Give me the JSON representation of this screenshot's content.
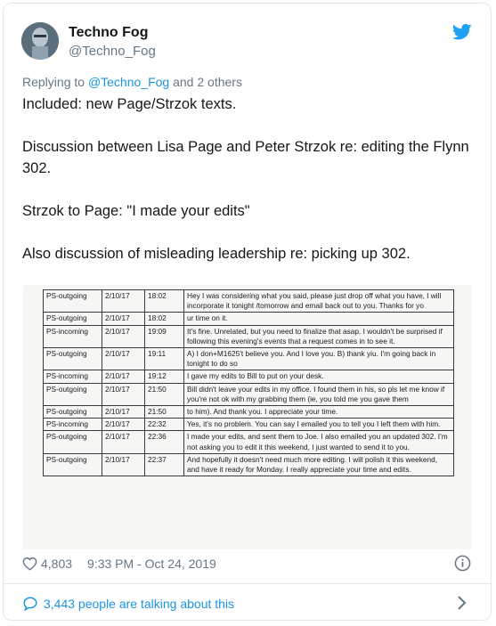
{
  "author": {
    "name": "Techno Fog",
    "handle": "@Techno_Fog"
  },
  "reply": {
    "prefix": "Replying to",
    "mention": "@Techno_Fog",
    "suffix": "and 2 others"
  },
  "tweet": {
    "paragraphs": [
      "Included: new Page/Strzok texts.",
      "Discussion between Lisa Page and Peter Strzok re: editing the Flynn 302.",
      "Strzok to Page: \"I made your edits\"",
      "Also discussion of misleading leadership re: picking up 302."
    ]
  },
  "document": {
    "rows": [
      {
        "dir": "PS-outgoing",
        "date": "2/10/17",
        "time": "18:02",
        "text": "Hey I was considering what you said, please just drop off what you have, I will incorporate it tonight /tomorrow and email back out to you. Thanks for yo"
      },
      {
        "dir": "PS-outgoing",
        "date": "2/10/17",
        "time": "18:02",
        "text": "ur time on it."
      },
      {
        "dir": "PS-incoming",
        "date": "2/10/17",
        "time": "19:09",
        "text": "It's fine.  Unrelated, but you need to finalize that asap.  I wouldn't be surprised if following this evening's events that a request comes in to see it."
      },
      {
        "dir": "PS-outgoing",
        "date": "2/10/17",
        "time": "19:11",
        "text": "A) I don+M1625't believe you. And I love you.  B) thank yiu. I'm going back in tonight to do so"
      },
      {
        "dir": "PS-incoming",
        "date": "2/10/17",
        "time": "19:12",
        "text": "I gave my edits to Bill to put on your desk."
      },
      {
        "dir": "PS-outgoing",
        "date": "2/10/17",
        "time": "21:50",
        "text": "Bill didn't leave your edits in my office. I found them in his, so pls let me know if you're not ok with my grabbing them (ie, you told me you gave them"
      },
      {
        "dir": "PS-outgoing",
        "date": "2/10/17",
        "time": "21:50",
        "text": "to him).  And thank you. I appreciate your time."
      },
      {
        "dir": "PS-incoming",
        "date": "2/10/17",
        "time": "22:32",
        "text": "Yes, it's no problem. You can say I emailed you to tell you I left them with him."
      },
      {
        "dir": "PS-outgoing",
        "date": "2/10/17",
        "time": "22:36",
        "text": "I made your edits, and sent them to Joe. I also emailed you an updated 302. I'm not asking you to edit it this weekend, I just wanted to send it to you."
      },
      {
        "dir": "PS-outgoing",
        "date": "2/10/17",
        "time": "22:37",
        "text": "And hopefully it doesn't need much more editing. I will polish it this weekend, and have it ready for Monday. I really appreciate your time and edits."
      }
    ]
  },
  "footer": {
    "likes": "4,803",
    "timestamp": "9:33 PM - Oct 24, 2019",
    "talking": "3,443 people are talking about this"
  },
  "colors": {
    "link": "#1b95e0",
    "muted": "#657786",
    "border": "#e1e8ed"
  },
  "icons": [
    "twitter-bird-icon",
    "heart-icon",
    "info-icon",
    "comment-icon",
    "chevron-right-icon"
  ]
}
